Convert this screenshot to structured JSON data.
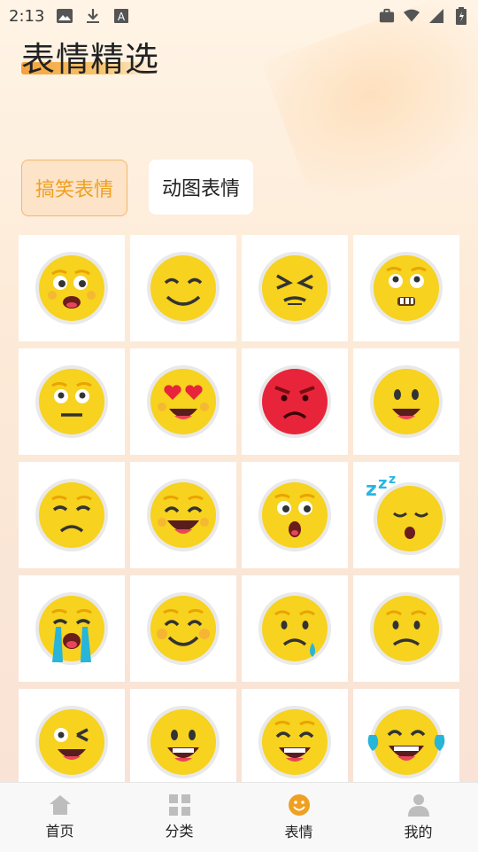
{
  "status_bar": {
    "time": "2:13",
    "icons": [
      "image-icon",
      "download-icon",
      "a-box-icon"
    ],
    "right_icons": [
      "briefcase-icon",
      "wifi-icon",
      "signal-icon",
      "battery-icon"
    ]
  },
  "header": {
    "title": "表情精选"
  },
  "tabs": [
    {
      "label": "搞笑表情",
      "active": true
    },
    {
      "label": "动图表情",
      "active": false
    }
  ],
  "emojis": [
    "shocked-face",
    "smiling-face",
    "squinting-face",
    "nervous-teeth-face",
    "neutral-face",
    "heart-eyes-face",
    "angry-red-face",
    "grinning-face",
    "disappointed-face",
    "grinning-eyes-closed-face",
    "surprised-face",
    "sleeping-face",
    "loudly-crying-face",
    "blushing-smile-face",
    "sad-tear-face",
    "slightly-frowning-face",
    "winking-face",
    "happy-grin-face",
    "grin-squint-face",
    "tears-of-joy-face"
  ],
  "bottom_nav": [
    {
      "label": "首页",
      "icon": "home-icon"
    },
    {
      "label": "分类",
      "icon": "grid-icon"
    },
    {
      "label": "表情",
      "icon": "smiley-icon",
      "active": true
    },
    {
      "label": "我的",
      "icon": "person-icon"
    }
  ],
  "colors": {
    "accent": "#f0a020",
    "emoji_yellow": "#f7d21e",
    "angry_red": "#e8243a"
  }
}
